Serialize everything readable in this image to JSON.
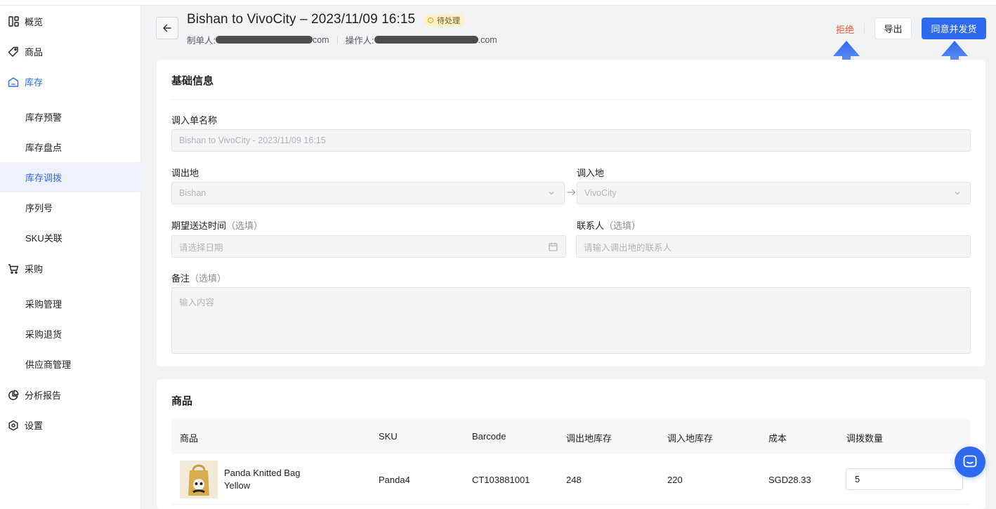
{
  "sidebar": {
    "items": [
      {
        "label": "概览",
        "icon": "overview-icon"
      },
      {
        "label": "商品",
        "icon": "tag-icon"
      },
      {
        "label": "库存",
        "icon": "warehouse-icon"
      },
      {
        "label": "库存预警"
      },
      {
        "label": "库存盘点"
      },
      {
        "label": "库存调拨"
      },
      {
        "label": "序列号"
      },
      {
        "label": "SKU关联"
      },
      {
        "label": "采购",
        "icon": "cart-icon"
      },
      {
        "label": "采购管理"
      },
      {
        "label": "采购退货"
      },
      {
        "label": "供应商管理"
      },
      {
        "label": "分析报告",
        "icon": "pie-chart-icon"
      },
      {
        "label": "设置",
        "icon": "settings-icon"
      }
    ],
    "active_item": "库存调拨"
  },
  "header": {
    "title": "Bishan to VivoCity – 2023/11/09 16:15",
    "status": "待处理",
    "creator_label": "制单人:",
    "creator_suffix": "com",
    "operator_label": "操作人:",
    "operator_suffix": ".com",
    "reject_label": "拒绝",
    "export_label": "导出",
    "approve_label": "同意并发货"
  },
  "basic": {
    "title": "基础信息",
    "name_label": "调入单名称",
    "name_value": "Bishan to VivoCity - 2023/11/09 16:15",
    "from_label": "调出地",
    "from_value": "Bishan",
    "to_label": "调入地",
    "to_value": "VivoCity",
    "eta_label": "期望送达时间",
    "eta_optional": "（选填）",
    "eta_placeholder": "请选择日期",
    "contact_label": "联系人",
    "contact_optional": "（选填）",
    "contact_placeholder": "请输入调出地的联系人",
    "remark_label": "备注",
    "remark_optional": "（选填）",
    "remark_placeholder": "输入内容"
  },
  "products": {
    "title": "商品",
    "columns": [
      "商品",
      "SKU",
      "Barcode",
      "调出地库存",
      "调入地库存",
      "成本",
      "调拨数量"
    ],
    "rows": [
      {
        "name_line1": "Panda Knitted Bag",
        "name_line2": "Yellow",
        "sku": "Panda4",
        "barcode": "CT103881001",
        "from_stock": "248",
        "to_stock": "220",
        "cost": "SGD28.33",
        "qty": "5"
      }
    ]
  },
  "colors": {
    "accent": "#2e6af0",
    "reject": "#f0522f",
    "badge": "#fdf0c8"
  }
}
